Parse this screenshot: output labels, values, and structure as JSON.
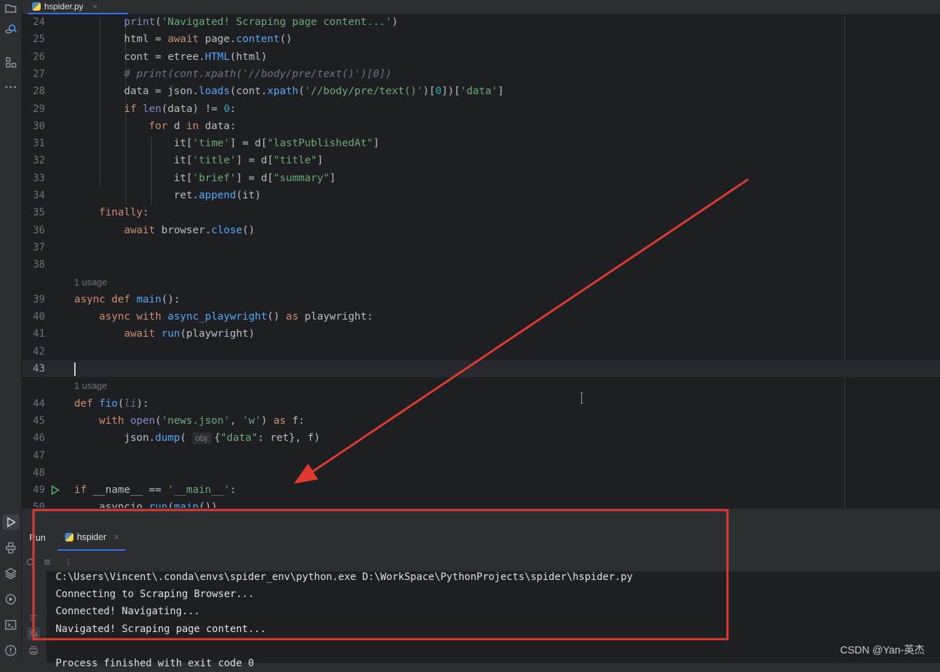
{
  "tab": {
    "filename": "hspider.py",
    "close": "×"
  },
  "editor": {
    "lines": [
      {
        "n": "24",
        "parts": [
          [
            "",
            "        "
          ],
          [
            "bi",
            "print"
          ],
          [
            "",
            "("
          ],
          [
            "str",
            "'Navigated! Scraping page content...'"
          ],
          [
            "",
            ")"
          ]
        ]
      },
      {
        "n": "25",
        "parts": [
          [
            "",
            "        html = "
          ],
          [
            "kw",
            "await"
          ],
          [
            "",
            " page."
          ],
          [
            "fn",
            "content"
          ],
          [
            "",
            "()"
          ]
        ]
      },
      {
        "n": "26",
        "parts": [
          [
            "",
            "        cont = etree."
          ],
          [
            "fn",
            "HTML"
          ],
          [
            "",
            "(html)"
          ]
        ]
      },
      {
        "n": "27",
        "parts": [
          [
            "pm",
            "        # print(cont.xpath('//body/pre/text()')[0])"
          ]
        ]
      },
      {
        "n": "28",
        "parts": [
          [
            "",
            "        data = json."
          ],
          [
            "fn",
            "loads"
          ],
          [
            "",
            "(cont."
          ],
          [
            "fn",
            "xpath"
          ],
          [
            "",
            "("
          ],
          [
            "str",
            "'//body/pre/text()'"
          ],
          [
            "",
            ")["
          ],
          [
            "num",
            "0"
          ],
          [
            "",
            "])["
          ],
          [
            "str",
            "'data'"
          ],
          [
            "",
            "]"
          ]
        ]
      },
      {
        "n": "29",
        "parts": [
          [
            "",
            "        "
          ],
          [
            "kw",
            "if"
          ],
          [
            "",
            " "
          ],
          [
            "bi",
            "len"
          ],
          [
            "",
            "(data) != "
          ],
          [
            "num",
            "0"
          ],
          [
            "",
            ":"
          ]
        ]
      },
      {
        "n": "30",
        "parts": [
          [
            "",
            "            "
          ],
          [
            "kw",
            "for"
          ],
          [
            "",
            " d "
          ],
          [
            "kw",
            "in"
          ],
          [
            "",
            " data:"
          ]
        ]
      },
      {
        "n": "31",
        "parts": [
          [
            "",
            "                it["
          ],
          [
            "str",
            "'time'"
          ],
          [
            "",
            "] = d["
          ],
          [
            "str",
            "\"lastPublishedAt\""
          ],
          [
            "",
            "]"
          ]
        ]
      },
      {
        "n": "32",
        "parts": [
          [
            "",
            "                it["
          ],
          [
            "str",
            "'title'"
          ],
          [
            "",
            "] = d["
          ],
          [
            "str",
            "\"title\""
          ],
          [
            "",
            "]"
          ]
        ]
      },
      {
        "n": "33",
        "parts": [
          [
            "",
            "                it["
          ],
          [
            "str",
            "'brief'"
          ],
          [
            "",
            "] = d["
          ],
          [
            "str",
            "\"summary\""
          ],
          [
            "",
            "]"
          ]
        ]
      },
      {
        "n": "34",
        "parts": [
          [
            "",
            "                ret."
          ],
          [
            "fn",
            "append"
          ],
          [
            "",
            "(it)"
          ]
        ]
      },
      {
        "n": "35",
        "parts": [
          [
            "",
            "    "
          ],
          [
            "kw",
            "finally"
          ],
          [
            "",
            ":"
          ]
        ]
      },
      {
        "n": "36",
        "parts": [
          [
            "",
            "        "
          ],
          [
            "kw",
            "await"
          ],
          [
            "",
            " browser."
          ],
          [
            "fn",
            "close"
          ],
          [
            "",
            "()"
          ]
        ]
      },
      {
        "n": "37",
        "parts": []
      },
      {
        "n": "38",
        "parts": []
      },
      {
        "n": "",
        "hint": "1 usage"
      },
      {
        "n": "39",
        "parts": [
          [
            "kw",
            "async def"
          ],
          [
            "",
            " "
          ],
          [
            "fn",
            "main"
          ],
          [
            "",
            "():"
          ]
        ]
      },
      {
        "n": "40",
        "parts": [
          [
            "",
            "    "
          ],
          [
            "kw",
            "async with"
          ],
          [
            "",
            " "
          ],
          [
            "fn",
            "async_playwright"
          ],
          [
            "",
            "() "
          ],
          [
            "kw",
            "as"
          ],
          [
            "",
            " playwright:"
          ]
        ]
      },
      {
        "n": "41",
        "parts": [
          [
            "",
            "        "
          ],
          [
            "kw",
            "await"
          ],
          [
            "",
            " "
          ],
          [
            "fn",
            "run"
          ],
          [
            "",
            "(playwright)"
          ]
        ]
      },
      {
        "n": "42",
        "parts": []
      },
      {
        "n": "43",
        "parts": [],
        "current": true
      },
      {
        "n": "",
        "hint": "1 usage"
      },
      {
        "n": "44",
        "parts": [
          [
            "kw",
            "def"
          ],
          [
            "",
            " "
          ],
          [
            "fn",
            "fio"
          ],
          [
            "",
            "("
          ],
          [
            "pm",
            "li"
          ],
          [
            "",
            "):"
          ]
        ]
      },
      {
        "n": "45",
        "parts": [
          [
            "",
            "    "
          ],
          [
            "kw",
            "with"
          ],
          [
            "",
            " "
          ],
          [
            "bi",
            "open"
          ],
          [
            "",
            "("
          ],
          [
            "str",
            "'news.json'"
          ],
          [
            "",
            ", "
          ],
          [
            "str",
            "'w'"
          ],
          [
            "",
            ") "
          ],
          [
            "kw",
            "as"
          ],
          [
            "",
            " f:"
          ]
        ]
      },
      {
        "n": "46",
        "parts": [
          [
            "",
            "        json."
          ],
          [
            "fn",
            "dump"
          ],
          [
            "",
            "( "
          ],
          [
            "inl",
            "obj:"
          ],
          [
            "",
            "{"
          ],
          [
            "str",
            "\"data\""
          ],
          [
            "",
            ": ret}, f)"
          ]
        ]
      },
      {
        "n": "47",
        "parts": []
      },
      {
        "n": "48",
        "parts": []
      },
      {
        "n": "49",
        "parts": [
          [
            "kw",
            "if"
          ],
          [
            "",
            " __name__ == "
          ],
          [
            "str",
            "'__main__'"
          ],
          [
            "",
            ":"
          ]
        ],
        "run": true
      },
      {
        "n": "50",
        "parts": [
          [
            "",
            "    asyncio."
          ],
          [
            "fn",
            "run"
          ],
          [
            "",
            "("
          ],
          [
            "fn",
            "main"
          ],
          [
            "",
            "())"
          ]
        ]
      }
    ]
  },
  "run_panel": {
    "label": "Run",
    "tab_name": "hspider",
    "tab_close": "×",
    "console": [
      "C:\\Users\\Vincent\\.conda\\envs\\spider_env\\python.exe D:\\WorkSpace\\PythonProjects\\spider\\hspider.py",
      "Connecting to Scraping Browser...",
      "Connected! Navigating...",
      "Navigated! Scraping page content...",
      "",
      "Process finished with exit code 0"
    ]
  },
  "watermark": "CSDN @Yan-英杰",
  "colors": {
    "annotation_red": "#e03a2f",
    "accent": "#3574f0",
    "editor_bg": "#1e1f22"
  }
}
